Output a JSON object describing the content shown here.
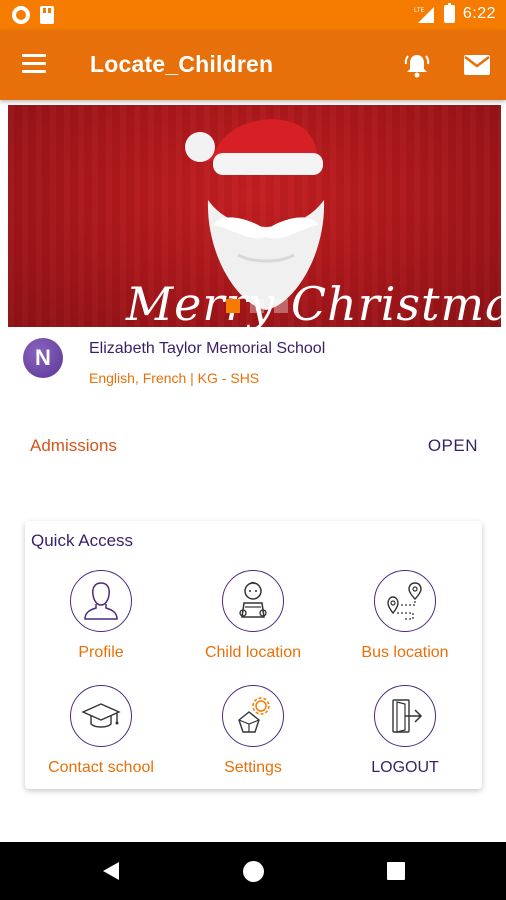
{
  "status_bar": {
    "time": "6:22",
    "icons": [
      "notification-circle-icon",
      "sd-card-icon",
      "lte-signal-icon",
      "battery-icon"
    ]
  },
  "app_bar": {
    "title": "Locate_Children",
    "icons": [
      "menu-icon",
      "alarm-bell-icon",
      "mail-icon"
    ]
  },
  "banner": {
    "text": "Merry Christmas",
    "slides": 3,
    "active_slide": 1
  },
  "school": {
    "avatar_letter": "N",
    "name": "Elizabeth Taylor Memorial School",
    "meta": "English, French | KG - SHS"
  },
  "admissions": {
    "label": "Admissions",
    "status": "OPEN"
  },
  "quick_access": {
    "title": "Quick Access",
    "items": [
      {
        "label": "Profile",
        "icon": "user-icon"
      },
      {
        "label": "Child location",
        "icon": "baby-icon"
      },
      {
        "label": "Bus location",
        "icon": "route-pin-icon"
      },
      {
        "label": "Contact school",
        "icon": "graduation-cap-icon"
      },
      {
        "label": "Settings",
        "icon": "settings-gear-icon"
      },
      {
        "label": "LOGOUT",
        "icon": "logout-icon"
      }
    ]
  },
  "colors": {
    "primary": "#e8700a",
    "status_bar": "#f57c00",
    "accent_purple": "#3a1f66",
    "banner_red": "#b0181c"
  }
}
